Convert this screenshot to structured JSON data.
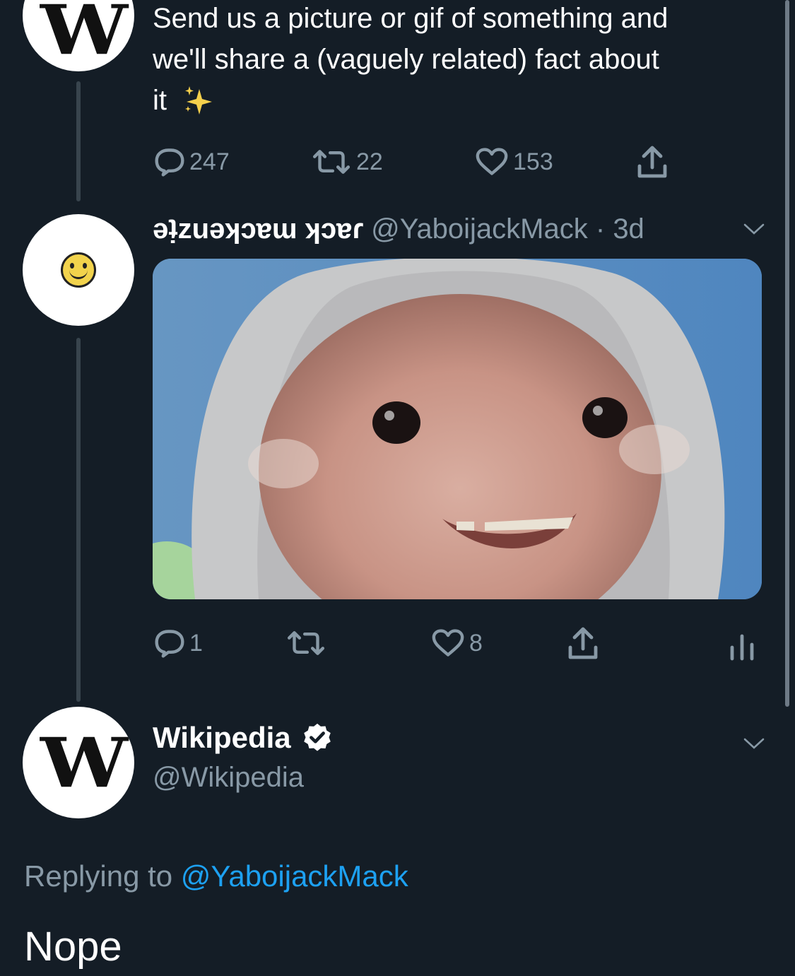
{
  "first_tweet": {
    "text_lines": [
      "Send us a picture or gif of something and",
      "we'll share a (vaguely related) fact about",
      "it"
    ],
    "sparkles_icon": "sparkles-emoji",
    "replies": "247",
    "retweets": "22",
    "likes": "153"
  },
  "second_tweet": {
    "display_name": "ǝʇ̣zuǝʞɔɐɯ ʞɔɐɾ",
    "handle": "@YaboijackMack",
    "separator": "·",
    "time": "3d",
    "replies": "1",
    "likes": "8",
    "media_description_icon": "photo"
  },
  "reply_tweet": {
    "display_name": "Wikipedia",
    "handle": "@Wikipedia",
    "replying_prefix": "Replying to",
    "replying_to": "@YaboijackMack",
    "text": "Nope"
  },
  "avatars": {
    "wikipedia_letter": "W",
    "smiley": "☺"
  },
  "colors": {
    "background": "#141d26",
    "muted": "#8899a6",
    "link": "#1da1f2",
    "verified": "#ffffff"
  }
}
